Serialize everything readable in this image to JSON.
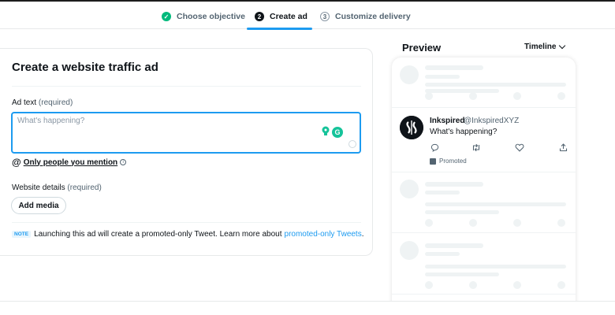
{
  "stepper": {
    "steps": [
      {
        "label": "Choose objective",
        "marker": "✓",
        "state": "complete"
      },
      {
        "label": "Create ad",
        "marker": "2",
        "state": "active"
      },
      {
        "label": "Customize delivery",
        "marker": "3",
        "state": "upcoming"
      }
    ]
  },
  "form": {
    "title": "Create a website traffic ad",
    "ad_text_label": "Ad text",
    "ad_text_required": "(required)",
    "ad_text_placeholder": "What's happening?",
    "ad_text_value": "",
    "mention_label": "Only people you mention",
    "website_label": "Website details",
    "website_required": "(required)",
    "add_media_label": "Add media",
    "note_badge": "NOTE",
    "note_text": "Launching this ad will create a promoted-only Tweet. Learn more about",
    "note_link": "promoted-only Tweets",
    "note_end": "."
  },
  "preview": {
    "title": "Preview",
    "view_selected": "Timeline",
    "tweet": {
      "name": "Inkspired",
      "handle": "@InkspiredXYZ",
      "text": "What's happening?",
      "promoted_label": "Promoted"
    }
  },
  "colors": {
    "accent": "#1d9bf0",
    "success": "#00ba7c",
    "text": "#0f1419",
    "muted": "#536471",
    "skeleton": "#eff3f4"
  }
}
